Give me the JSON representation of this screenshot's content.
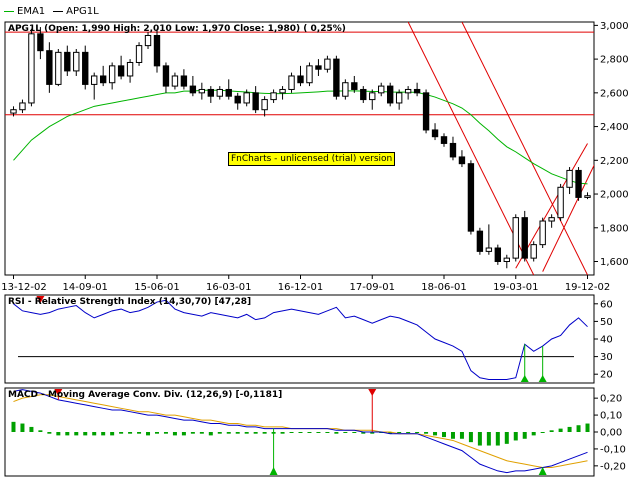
{
  "legend": [
    {
      "name": "EMA1",
      "color": "#00b400"
    },
    {
      "name": "APG1L",
      "color": "#000000"
    }
  ],
  "watermark": "FnCharts - unlicensed (trial) version",
  "panels": {
    "price": {
      "title": "APG1L (Open: 1,990  High: 2,010  Low: 1,970  Close: 1,980) ( 0,25%)"
    },
    "rsi": {
      "title": "RSI - Relative Strength Index (14,30,70) [47,28]"
    },
    "macd": {
      "title": "MACD - Moving Average Conv. Div. (12,26,9) [-0,1181]"
    }
  },
  "colors": {
    "up": "#ffffff",
    "down": "#000000",
    "ema": "#00b400",
    "rsi": "#0000c8",
    "macd": "#0000c8",
    "signal": "#e0a000",
    "hist": "#00a000",
    "levels": "#e00000",
    "buy": "#00b400",
    "sell": "#e00000"
  },
  "chart_data": [
    {
      "type": "candlestick",
      "x_ticks": [
        "13-12-02",
        "14-09-01",
        "15-06-01",
        "16-03-01",
        "16-12-01",
        "17-09-01",
        "18-06-01",
        "19-03-01",
        "19-12-02"
      ],
      "y_ticks": [
        1600,
        1800,
        2000,
        2200,
        2400,
        2600,
        2800,
        3000
      ],
      "ylim": [
        1520,
        3020
      ],
      "ohlc": [
        [
          2480,
          2520,
          2460,
          2500
        ],
        [
          2500,
          2560,
          2480,
          2540
        ],
        [
          2540,
          2980,
          2520,
          2950
        ],
        [
          2950,
          2990,
          2800,
          2850
        ],
        [
          2850,
          2900,
          2600,
          2650
        ],
        [
          2650,
          2860,
          2640,
          2840
        ],
        [
          2840,
          2880,
          2700,
          2730
        ],
        [
          2730,
          2860,
          2700,
          2840
        ],
        [
          2840,
          2880,
          2620,
          2650
        ],
        [
          2650,
          2720,
          2560,
          2700
        ],
        [
          2700,
          2760,
          2640,
          2660
        ],
        [
          2660,
          2780,
          2620,
          2760
        ],
        [
          2760,
          2820,
          2680,
          2700
        ],
        [
          2700,
          2800,
          2660,
          2780
        ],
        [
          2780,
          2900,
          2760,
          2880
        ],
        [
          2880,
          2960,
          2860,
          2940
        ],
        [
          2940,
          2980,
          2720,
          2760
        ],
        [
          2760,
          2780,
          2600,
          2640
        ],
        [
          2640,
          2720,
          2620,
          2700
        ],
        [
          2700,
          2740,
          2620,
          2640
        ],
        [
          2640,
          2700,
          2580,
          2600
        ],
        [
          2600,
          2660,
          2560,
          2620
        ],
        [
          2620,
          2640,
          2540,
          2580
        ],
        [
          2580,
          2640,
          2560,
          2620
        ],
        [
          2620,
          2680,
          2560,
          2580
        ],
        [
          2580,
          2600,
          2500,
          2540
        ],
        [
          2540,
          2620,
          2520,
          2600
        ],
        [
          2600,
          2640,
          2480,
          2500
        ],
        [
          2500,
          2580,
          2460,
          2560
        ],
        [
          2560,
          2620,
          2540,
          2600
        ],
        [
          2600,
          2640,
          2560,
          2620
        ],
        [
          2620,
          2720,
          2600,
          2700
        ],
        [
          2700,
          2760,
          2640,
          2660
        ],
        [
          2660,
          2780,
          2640,
          2760
        ],
        [
          2760,
          2800,
          2700,
          2740
        ],
        [
          2740,
          2820,
          2720,
          2800
        ],
        [
          2800,
          2820,
          2560,
          2580
        ],
        [
          2580,
          2680,
          2560,
          2660
        ],
        [
          2660,
          2700,
          2600,
          2620
        ],
        [
          2620,
          2640,
          2540,
          2560
        ],
        [
          2560,
          2620,
          2500,
          2600
        ],
        [
          2600,
          2660,
          2580,
          2640
        ],
        [
          2640,
          2660,
          2520,
          2540
        ],
        [
          2540,
          2620,
          2500,
          2600
        ],
        [
          2600,
          2640,
          2560,
          2620
        ],
        [
          2620,
          2660,
          2580,
          2600
        ],
        [
          2600,
          2620,
          2360,
          2380
        ],
        [
          2380,
          2420,
          2320,
          2340
        ],
        [
          2340,
          2360,
          2280,
          2300
        ],
        [
          2300,
          2340,
          2200,
          2220
        ],
        [
          2220,
          2260,
          2160,
          2180
        ],
        [
          2180,
          2200,
          1760,
          1780
        ],
        [
          1780,
          1800,
          1640,
          1660
        ],
        [
          1660,
          1820,
          1640,
          1680
        ],
        [
          1680,
          1700,
          1580,
          1600
        ],
        [
          1600,
          1640,
          1560,
          1620
        ],
        [
          1620,
          1880,
          1600,
          1860
        ],
        [
          1860,
          1900,
          1600,
          1620
        ],
        [
          1620,
          1720,
          1600,
          1700
        ],
        [
          1700,
          1860,
          1680,
          1840
        ],
        [
          1840,
          1880,
          1800,
          1860
        ],
        [
          1860,
          2060,
          1840,
          2040
        ],
        [
          2040,
          2160,
          2000,
          2140
        ],
        [
          2140,
          2160,
          1960,
          1980
        ],
        [
          1980,
          2010,
          1970,
          1990
        ]
      ],
      "ema": [
        2200,
        2260,
        2320,
        2360,
        2400,
        2430,
        2460,
        2480,
        2500,
        2520,
        2530,
        2540,
        2550,
        2560,
        2570,
        2580,
        2590,
        2600,
        2600,
        2610,
        2610,
        2615,
        2615,
        2615,
        2612,
        2608,
        2605,
        2600,
        2597,
        2595,
        2595,
        2597,
        2600,
        2603,
        2606,
        2610,
        2610,
        2612,
        2612,
        2610,
        2608,
        2608,
        2605,
        2604,
        2604,
        2603,
        2590,
        2575,
        2555,
        2535,
        2510,
        2470,
        2420,
        2375,
        2325,
        2280,
        2250,
        2215,
        2180,
        2150,
        2120,
        2100,
        2080,
        2065,
        2060
      ],
      "hlines": [
        2960,
        2470
      ],
      "trendlines": [
        {
          "from": [
            44,
            3020
          ],
          "to": [
            58,
            1520
          ]
        },
        {
          "from": [
            50,
            3020
          ],
          "to": [
            64,
            1520
          ]
        },
        {
          "from": [
            56,
            1560
          ],
          "to": [
            64,
            2300
          ]
        },
        {
          "from": [
            59,
            1540
          ],
          "to": [
            65,
            2200
          ]
        }
      ]
    },
    {
      "type": "line",
      "ylim": [
        15,
        65
      ],
      "y_ticks": [
        20,
        30,
        40,
        50,
        60
      ],
      "levels": [
        30
      ],
      "values": [
        60,
        56,
        55,
        54,
        55,
        57,
        58,
        59,
        55,
        52,
        54,
        56,
        57,
        55,
        56,
        58,
        61,
        62,
        57,
        55,
        54,
        53,
        55,
        54,
        53,
        52,
        54,
        51,
        52,
        55,
        56,
        57,
        56,
        55,
        54,
        56,
        58,
        52,
        53,
        51,
        49,
        51,
        53,
        52,
        50,
        48,
        44,
        40,
        38,
        36,
        33,
        22,
        18,
        17,
        17,
        17,
        18,
        37,
        33,
        36,
        40,
        42,
        48,
        52,
        47
      ],
      "buy_markers": [
        57,
        59
      ],
      "sell_markers": [
        3
      ]
    },
    {
      "type": "bar+line",
      "ylim": [
        -0.26,
        0.26
      ],
      "y_ticks": [
        -0.2,
        -0.1,
        0.0,
        0.1,
        0.2
      ],
      "macd": [
        0.24,
        0.25,
        0.24,
        0.23,
        0.21,
        0.19,
        0.18,
        0.17,
        0.16,
        0.15,
        0.14,
        0.13,
        0.13,
        0.12,
        0.11,
        0.1,
        0.1,
        0.09,
        0.08,
        0.07,
        0.07,
        0.06,
        0.05,
        0.05,
        0.04,
        0.04,
        0.03,
        0.03,
        0.02,
        0.02,
        0.02,
        0.02,
        0.02,
        0.02,
        0.02,
        0.02,
        0.01,
        0.01,
        0.01,
        0.0,
        0.0,
        0.0,
        -0.01,
        -0.01,
        -0.01,
        -0.01,
        -0.03,
        -0.05,
        -0.07,
        -0.09,
        -0.11,
        -0.15,
        -0.19,
        -0.21,
        -0.23,
        -0.24,
        -0.23,
        -0.23,
        -0.22,
        -0.21,
        -0.2,
        -0.18,
        -0.16,
        -0.14,
        -0.12
      ],
      "signal": [
        0.18,
        0.2,
        0.21,
        0.22,
        0.22,
        0.21,
        0.2,
        0.19,
        0.18,
        0.17,
        0.16,
        0.15,
        0.14,
        0.13,
        0.12,
        0.12,
        0.11,
        0.1,
        0.1,
        0.09,
        0.08,
        0.07,
        0.07,
        0.06,
        0.05,
        0.05,
        0.04,
        0.04,
        0.03,
        0.03,
        0.03,
        0.02,
        0.02,
        0.02,
        0.02,
        0.02,
        0.02,
        0.01,
        0.01,
        0.01,
        0.01,
        0.0,
        0.0,
        -0.01,
        -0.01,
        -0.01,
        -0.02,
        -0.03,
        -0.04,
        -0.05,
        -0.07,
        -0.09,
        -0.11,
        -0.13,
        -0.15,
        -0.17,
        -0.18,
        -0.19,
        -0.2,
        -0.21,
        -0.21,
        -0.2,
        -0.19,
        -0.18,
        -0.17
      ],
      "buy_markers": [
        29,
        59
      ],
      "sell_markers": [
        5,
        40
      ]
    }
  ]
}
